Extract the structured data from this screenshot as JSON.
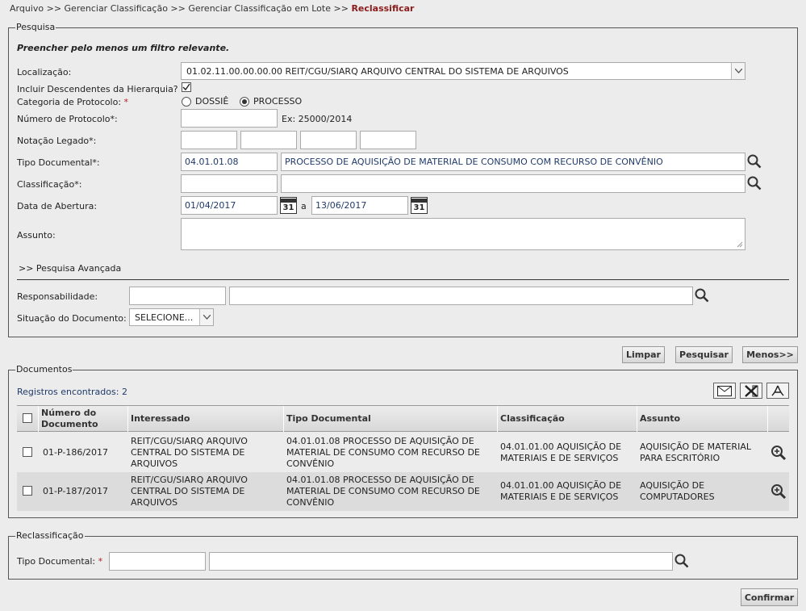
{
  "breadcrumb": {
    "path": "Arquivo >> Gerenciar Classificação >> Gerenciar Classificação em Lote >>",
    "current": "Reclassificar"
  },
  "pesquisa": {
    "legend": "Pesquisa",
    "instruction": "Preencher pelo menos um filtro relevante.",
    "localizacao_label": "Localização:",
    "localizacao_value": "01.02.11.00.00.00.00 REIT/CGU/SIARQ ARQUIVO CENTRAL DO SISTEMA DE ARQUIVOS",
    "incluir_label": "Incluir Descendentes da Hierarquia?",
    "incluir_checked": true,
    "categoria_label": "Categoria de Protocolo:",
    "categoria_required": "*",
    "categoria_options": [
      "DOSSIÊ",
      "PROCESSO"
    ],
    "categoria_selected": "PROCESSO",
    "numero_label": "Número de Protocolo*:",
    "numero_value": "",
    "numero_hint": "Ex: 25000/2014",
    "notacao_label": "Notação Legado*:",
    "tipo_label": "Tipo Documental*:",
    "tipo_code": "04.01.01.08",
    "tipo_desc": "PROCESSO DE AQUISIÇÃO DE MATERIAL DE CONSUMO COM RECURSO DE CONVÊNIO",
    "classificacao_label": "Classificação*:",
    "data_label": "Data de Abertura:",
    "data_from": "01/04/2017",
    "data_sep": "a",
    "data_to": "13/06/2017",
    "calendar_day": "31",
    "assunto_label": "Assunto:",
    "avancada_label": ">> Pesquisa Avançada",
    "responsabilidade_label": "Responsabilidade:",
    "situacao_label": "Situação do Documento:",
    "situacao_value": "SELECIONE..."
  },
  "actions": {
    "limpar": "Limpar",
    "pesquisar": "Pesquisar",
    "menos": "Menos>>"
  },
  "documentos": {
    "legend": "Documentos",
    "count_text": "Registros encontrados: 2",
    "columns": [
      "Número do Documento",
      "Interessado",
      "Tipo Documental",
      "Classificação",
      "Assunto"
    ],
    "rows": [
      {
        "numero": "01-P-186/2017",
        "interessado": "REIT/CGU/SIARQ ARQUIVO CENTRAL DO SISTEMA DE ARQUIVOS",
        "tipo": "04.01.01.08 PROCESSO DE AQUISIÇÃO DE MATERIAL DE CONSUMO COM RECURSO DE CONVÊNIO",
        "classificacao": "04.01.01.00 AQUISIÇÃO DE MATERIAIS E DE SERVIÇOS",
        "assunto": "AQUISIÇÃO DE MATERIAL PARA ESCRITÓRIO"
      },
      {
        "numero": "01-P-187/2017",
        "interessado": "REIT/CGU/SIARQ ARQUIVO CENTRAL DO SISTEMA DE ARQUIVOS",
        "tipo": "04.01.01.08 PROCESSO DE AQUISIÇÃO DE MATERIAL DE CONSUMO COM RECURSO DE CONVÊNIO",
        "classificacao": "04.01.01.00 AQUISIÇÃO DE MATERIAIS E DE SERVIÇOS",
        "assunto": "AQUISIÇÃO DE COMPUTADORES"
      }
    ]
  },
  "reclassificacao": {
    "legend": "Reclassificação",
    "tipo_label": "Tipo Documental:",
    "required": "*"
  },
  "confirmar": "Confirmar",
  "colors": {
    "breadcrumb_current": "#8b1a1a",
    "count_text": "#1f3a6b",
    "row_alt": "#dcdcdc"
  }
}
